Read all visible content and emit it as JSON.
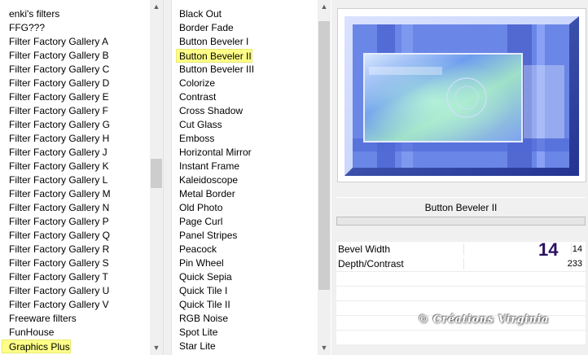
{
  "categories": {
    "items": [
      "enki's filters",
      "FFG???",
      "Filter Factory Gallery A",
      "Filter Factory Gallery B",
      "Filter Factory Gallery C",
      "Filter Factory Gallery D",
      "Filter Factory Gallery E",
      "Filter Factory Gallery F",
      "Filter Factory Gallery G",
      "Filter Factory Gallery H",
      "Filter Factory Gallery J",
      "Filter Factory Gallery K",
      "Filter Factory Gallery L",
      "Filter Factory Gallery M",
      "Filter Factory Gallery N",
      "Filter Factory Gallery P",
      "Filter Factory Gallery Q",
      "Filter Factory Gallery R",
      "Filter Factory Gallery S",
      "Filter Factory Gallery T",
      "Filter Factory Gallery U",
      "Filter Factory Gallery V",
      "Freeware filters",
      "FunHouse",
      "Graphics Plus"
    ],
    "selected_index": 24
  },
  "filters": {
    "items": [
      "Black Out",
      "Border Fade",
      "Button Beveler I",
      "Button Beveler II",
      "Button Beveler III",
      "Colorize",
      "Contrast",
      "Cross Shadow",
      "Cut Glass",
      "Emboss",
      "Horizontal Mirror",
      "Instant Frame",
      "Kaleidoscope",
      "Metal Border",
      "Old Photo",
      "Page Curl",
      "Panel Stripes",
      "Peacock",
      "Pin Wheel",
      "Quick Sepia",
      "Quick Tile I",
      "Quick Tile II",
      "RGB Noise",
      "Spot Lite",
      "Star Lite"
    ],
    "selected_index": 3
  },
  "preview": {
    "filter_name": "Button Beveler II"
  },
  "params": [
    {
      "name": "Bevel Width",
      "value": "14"
    },
    {
      "name": "Depth/Contrast",
      "value": "233"
    }
  ],
  "annotation": {
    "big_number": "14"
  },
  "watermark": "© Créations Virginia",
  "scroll_arrows": {
    "up": "▲",
    "down": "▼"
  }
}
